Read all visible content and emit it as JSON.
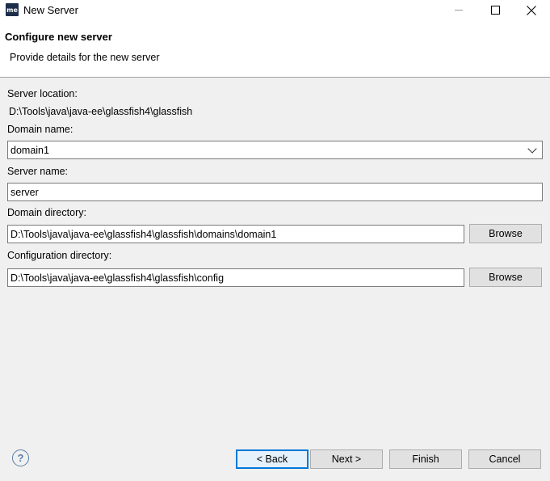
{
  "window": {
    "app_icon_text": "me",
    "title": "New Server"
  },
  "header": {
    "title": "Configure new server",
    "description": "Provide details for the new server"
  },
  "form": {
    "server_location_label": "Server location:",
    "server_location_value": "D:\\Tools\\java\\java-ee\\glassfish4\\glassfish",
    "domain_name_label": "Domain name:",
    "domain_name_value": "domain1",
    "server_name_label": "Server name:",
    "server_name_value": "server",
    "domain_directory_label": "Domain directory:",
    "domain_directory_value": "D:\\Tools\\java\\java-ee\\glassfish4\\glassfish\\domains\\domain1",
    "config_directory_label": "Configuration directory:",
    "config_directory_value": "D:\\Tools\\java\\java-ee\\glassfish4\\glassfish\\config",
    "browse_label": "Browse"
  },
  "footer": {
    "help_icon": "?",
    "back_label": "< Back",
    "next_label": "Next >",
    "finish_label": "Finish",
    "cancel_label": "Cancel"
  },
  "colors": {
    "default_button_border": "#0078d7",
    "dialog_background": "#f0f0f0"
  }
}
